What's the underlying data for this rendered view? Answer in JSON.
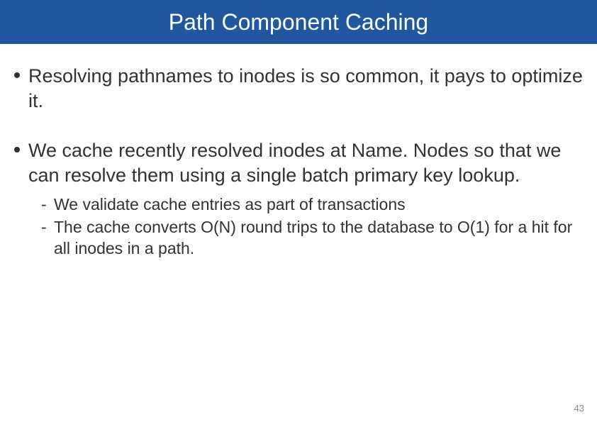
{
  "slide": {
    "title": "Path Component Caching",
    "bullets": [
      {
        "text": "Resolving pathnames to inodes is so common, it pays to optimize it.",
        "subs": []
      },
      {
        "text": "We cache recently resolved inodes at Name. Nodes so that we can resolve them using a single batch primary key lookup.",
        "subs": [
          "We validate cache entries as part of transactions",
          "The cache converts O(N) round trips to the database to O(1) for a hit for all inodes in a path."
        ]
      }
    ],
    "page_number": "43"
  }
}
